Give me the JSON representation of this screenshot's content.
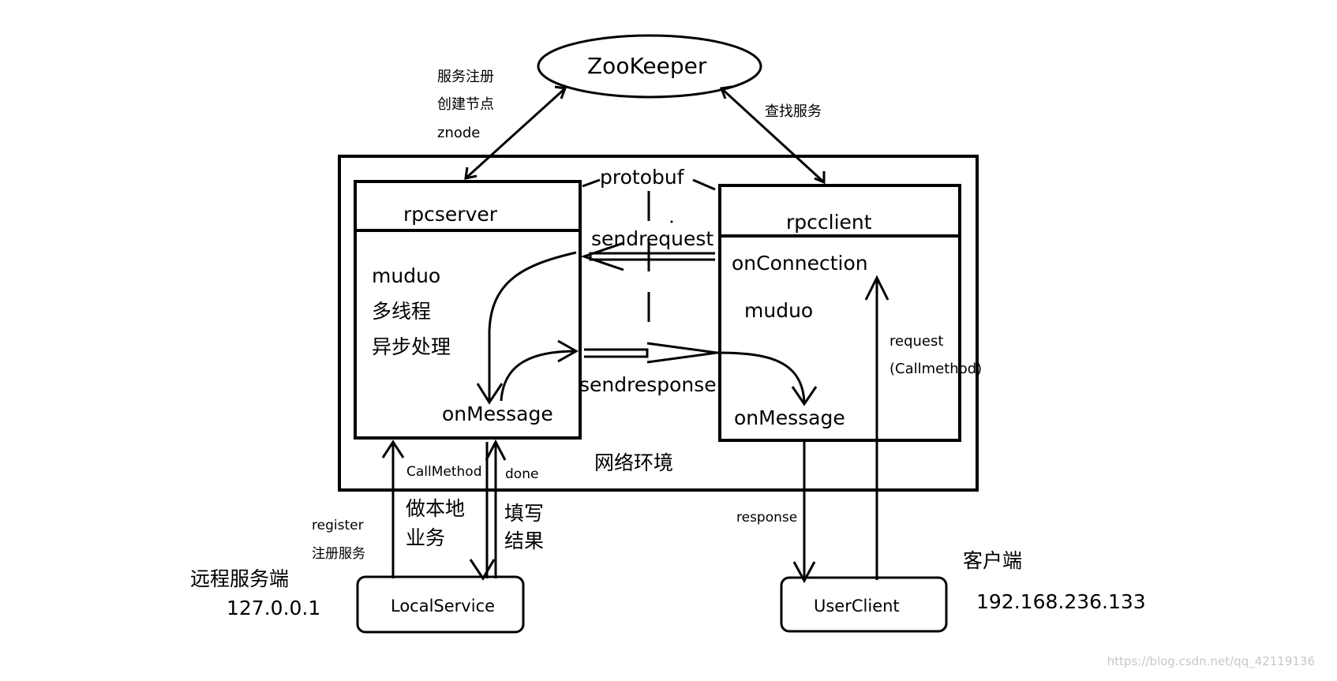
{
  "diagram": {
    "zookeeper": "ZooKeeper",
    "left_registration": {
      "line1": "服务注册",
      "line2": "创建节点",
      "line3": "znode"
    },
    "right_lookup": "查找服务",
    "protobuf": "protobuf",
    "rpcserver": {
      "title": "rpcserver",
      "line1": "muduo",
      "line2": "多线程",
      "line3": "异步处理",
      "onmessage": "onMessage"
    },
    "rpcclient": {
      "title": "rpcclient",
      "onconnection": "onConnection",
      "muduo": "muduo",
      "onmessage": "onMessage",
      "request": "request",
      "callmethod": "(Callmethod)"
    },
    "sendrequest": "sendrequest",
    "sendresponse": "sendresponse",
    "network": "网络环境",
    "bottom_left": {
      "callmethod": "CallMethod",
      "done": "done",
      "local_work_1": "做本地",
      "local_work_2": "业务",
      "fill_result_1": "填写",
      "fill_result_2": "结果",
      "register": "register",
      "register_service": "注册服务",
      "remote_title": "远程服务端",
      "remote_ip": "127.0.0.1",
      "service": "LocalService"
    },
    "bottom_right": {
      "response": "response",
      "client_title": "客户端",
      "client_ip": "192.168.236.133",
      "client": "UserClient"
    },
    "watermark": "https://blog.csdn.net/qq_42119136"
  }
}
